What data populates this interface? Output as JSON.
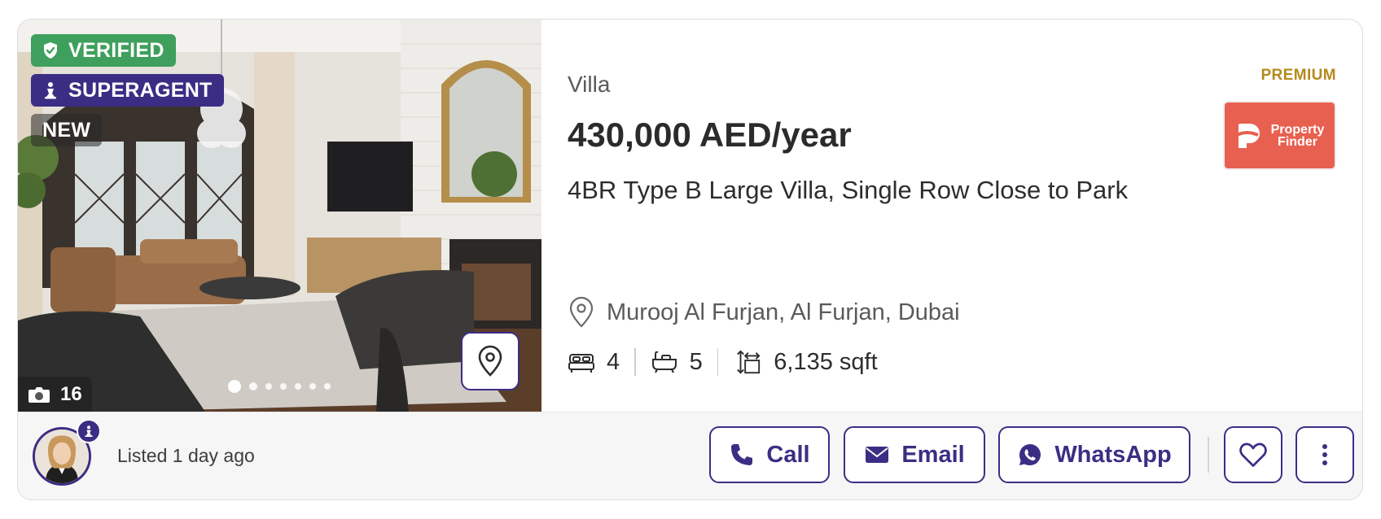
{
  "listing": {
    "badges": {
      "verified": "VERIFIED",
      "superagent": "SUPERAGENT",
      "new": "NEW"
    },
    "photo_count": "16",
    "carousel": {
      "total_dots": 7,
      "active_index": 0
    },
    "property_type": "Villa",
    "price": "430,000 AED/year",
    "title": "4BR Type B Large Villa, Single Row Close to Park",
    "tier": "PREMIUM",
    "source_logo": {
      "line1": "Property",
      "line2": "Finder",
      "color": "#e8604f"
    },
    "location": "Murooj Al Furjan, Al Furjan, Dubai",
    "specs": {
      "bedrooms": "4",
      "bathrooms": "5",
      "area": "6,135 sqft"
    },
    "listed": "Listed 1 day ago"
  },
  "actions": {
    "call": "Call",
    "email": "Email",
    "whatsapp": "WhatsApp"
  },
  "icons": {
    "verified": "shield-check-icon",
    "superagent": "chess-pawn-icon",
    "photo_count": "camera-icon",
    "map": "map-pin-icon",
    "location": "location-pin-icon",
    "bedrooms": "bed-icon",
    "bathrooms": "bathtub-icon",
    "area": "area-icon",
    "call": "phone-icon",
    "email": "envelope-icon",
    "whatsapp": "whatsapp-icon",
    "favorite": "heart-icon",
    "more": "more-vertical-icon"
  },
  "colors": {
    "accent": "#3c2d84",
    "verified": "#3f9f5c",
    "premium": "#b58a1d"
  }
}
